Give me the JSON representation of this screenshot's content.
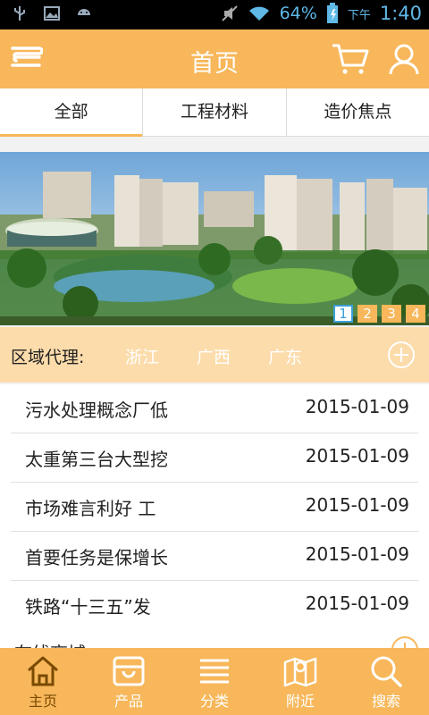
{
  "status_bar": {
    "battery_percent": "64%",
    "ampm": "下午",
    "time": "1:40",
    "icons": [
      "usb-icon",
      "image-icon",
      "android-icon",
      "mute-icon",
      "wifi-icon",
      "battery-charging-icon"
    ]
  },
  "header": {
    "title": "首页",
    "icons": [
      "menu-icon",
      "cart-icon",
      "user-icon"
    ]
  },
  "tabs": [
    {
      "label": "全部",
      "active": true
    },
    {
      "label": "工程材料",
      "active": false
    },
    {
      "label": "造价焦点",
      "active": false
    }
  ],
  "banner": {
    "pages": [
      "1",
      "2",
      "3",
      "4"
    ],
    "active_page": 1
  },
  "region": {
    "label": "区域代理:",
    "cities": [
      "浙江",
      "广西",
      "广东"
    ]
  },
  "news": [
    {
      "title": "污水处理概念厂低",
      "date": "2015-01-09"
    },
    {
      "title": "太重第三台大型挖",
      "date": "2015-01-09"
    },
    {
      "title": "市场难言利好 工",
      "date": "2015-01-09"
    },
    {
      "title": "首要任务是保增长",
      "date": "2015-01-09"
    },
    {
      "title": "铁路“十三五”发",
      "date": "2015-01-09"
    }
  ],
  "section_partial": {
    "title": "在线商城"
  },
  "tabbar": [
    {
      "label": "主页",
      "icon": "home-icon",
      "active": true
    },
    {
      "label": "产品",
      "icon": "bag-icon",
      "active": false
    },
    {
      "label": "分类",
      "icon": "list-icon",
      "active": false
    },
    {
      "label": "附近",
      "icon": "map-icon",
      "active": false
    },
    {
      "label": "搜索",
      "icon": "search-icon",
      "active": false
    }
  ],
  "colors": {
    "accent": "#f7b75a",
    "region_bg": "#fcdcab",
    "status_icon": "#5fb8e6"
  }
}
